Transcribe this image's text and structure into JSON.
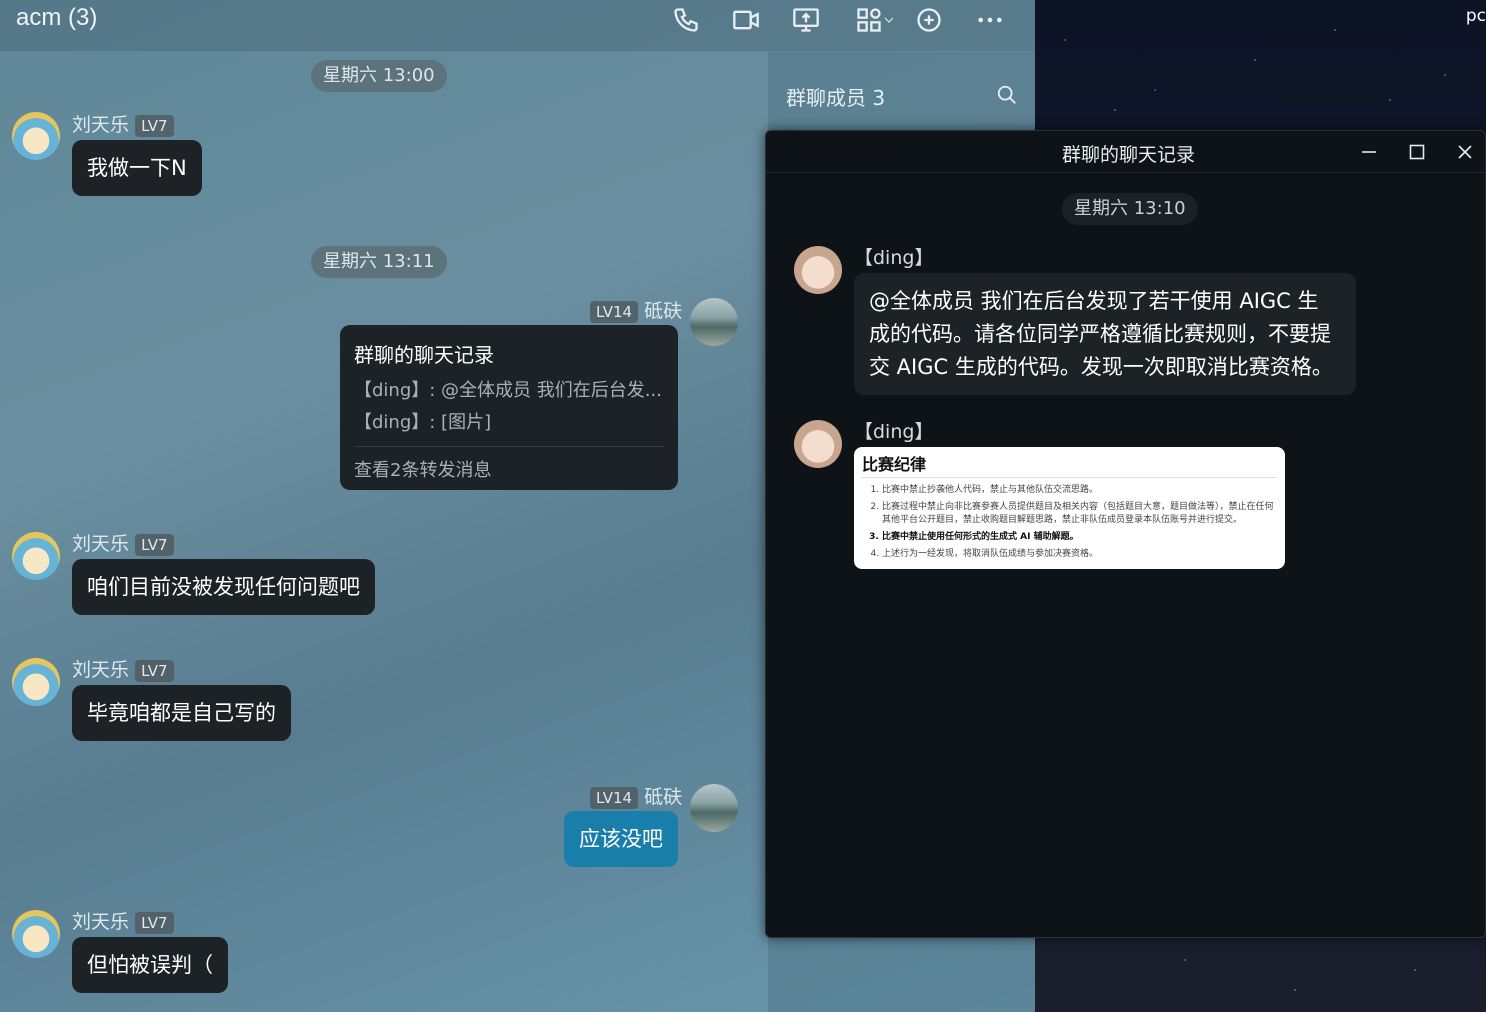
{
  "chat": {
    "title": "acm (3)",
    "members_title": "群聊成员 3"
  },
  "toolbar": {
    "icons": [
      "phone-icon",
      "video-icon",
      "screen-share-icon",
      "apps-icon",
      "add-icon",
      "more-icon"
    ]
  },
  "messages": {
    "time1": "星期六 13:00",
    "time2": "星期六 13:11",
    "m1": {
      "sender": "刘天乐",
      "level": "LV7",
      "text": "我做一下N"
    },
    "m2": {
      "sender": "砥砆",
      "level": "LV14"
    },
    "forward": {
      "title": "群聊的聊天记录",
      "line1": "【ding】: @全体成员 我们在后台发...",
      "line2": "【ding】: [图片]",
      "footer": "查看2条转发消息"
    },
    "m3": {
      "sender": "刘天乐",
      "level": "LV7",
      "text": "咱们目前没被发现任何问题吧"
    },
    "m4": {
      "sender": "刘天乐",
      "level": "LV7",
      "text": "毕竟咱都是自己写的"
    },
    "m5": {
      "sender": "砥砆",
      "level": "LV14",
      "text": "应该没吧"
    },
    "m6": {
      "sender": "刘天乐",
      "level": "LV7",
      "text": "但怕被误判（"
    }
  },
  "popup": {
    "title": "群聊的聊天记录",
    "time": "星期六 13:10",
    "sender": "【ding】",
    "announcement_line1": "@全体成员  我们在后台发现了若干使用 AIGC 生",
    "announcement_line2": "成的代码。请各位同学严格遵循比赛规则，不要提",
    "announcement_line3": "交 AIGC 生成的代码。发现一次即取消比赛资格。",
    "image": {
      "heading": "比赛纪律",
      "rules": [
        "比赛中禁止抄袭他人代码，禁止与其他队伍交流思路。",
        "比赛过程中禁止向非比赛参赛人员提供题目及相关内容（包括题目大意，题目做法等），禁止在任何其他平台公开题目，禁止收购题目解题思路，禁止非队伍成员登录本队伍账号并进行提交。",
        "比赛中禁止使用任何形式的生成式 AI 辅助解题。",
        "上述行为一经发现，将取消队伍成绩与参加决赛资格。"
      ]
    }
  },
  "desktop": {
    "text": "pc"
  }
}
